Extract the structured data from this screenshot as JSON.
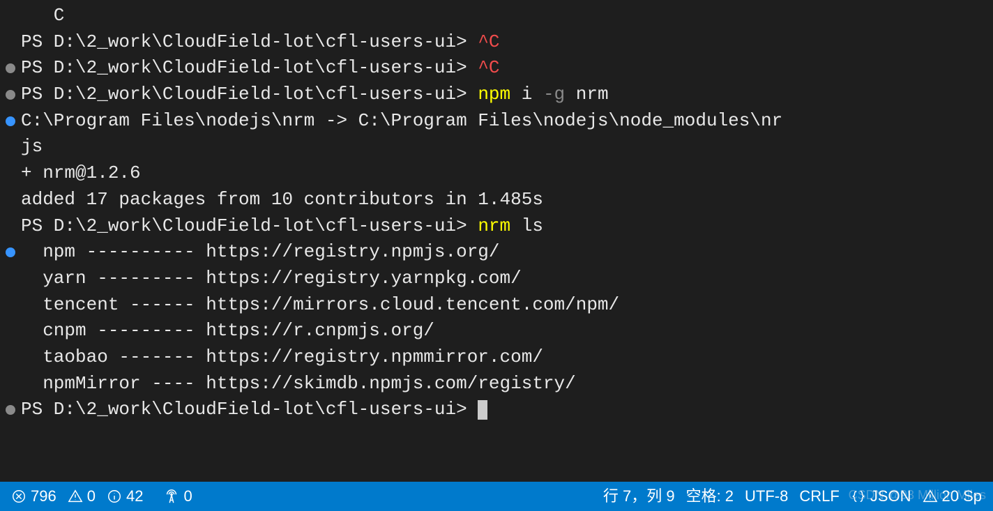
{
  "lines": [
    {
      "marker": "",
      "segments": [
        {
          "cls": "white",
          "t": "   C"
        }
      ]
    },
    {
      "marker": "",
      "segments": [
        {
          "cls": "white",
          "t": "PS D:\\2_work\\CloudField-lot\\cfl-users-ui> "
        },
        {
          "cls": "red",
          "t": "^C"
        }
      ]
    },
    {
      "marker": "grey",
      "segments": [
        {
          "cls": "white",
          "t": "PS D:\\2_work\\CloudField-lot\\cfl-users-ui> "
        },
        {
          "cls": "red",
          "t": "^C"
        }
      ]
    },
    {
      "marker": "grey",
      "segments": [
        {
          "cls": "white",
          "t": "PS D:\\2_work\\CloudField-lot\\cfl-users-ui> "
        },
        {
          "cls": "yellow",
          "t": "npm"
        },
        {
          "cls": "white",
          "t": " i "
        },
        {
          "cls": "grey",
          "t": "-g"
        },
        {
          "cls": "white",
          "t": " nrm"
        }
      ]
    },
    {
      "marker": "blue",
      "segments": [
        {
          "cls": "white",
          "t": "C:\\Program Files\\nodejs\\nrm -> C:\\Program Files\\nodejs\\node_modules\\nr"
        }
      ]
    },
    {
      "marker": "",
      "segments": [
        {
          "cls": "white",
          "t": "js"
        }
      ]
    },
    {
      "marker": "",
      "segments": [
        {
          "cls": "white",
          "t": "+ nrm@1.2.6"
        }
      ]
    },
    {
      "marker": "",
      "segments": [
        {
          "cls": "white",
          "t": "added 17 packages from 10 contributors in 1.485s"
        }
      ]
    },
    {
      "marker": "",
      "segments": [
        {
          "cls": "white",
          "t": "PS D:\\2_work\\CloudField-lot\\cfl-users-ui> "
        },
        {
          "cls": "yellow",
          "t": "nrm"
        },
        {
          "cls": "white",
          "t": " ls"
        }
      ]
    },
    {
      "marker": "blue",
      "segments": [
        {
          "cls": "white",
          "t": "  npm ---------- https://registry.npmjs.org/"
        }
      ]
    },
    {
      "marker": "",
      "segments": [
        {
          "cls": "white",
          "t": "  yarn --------- https://registry.yarnpkg.com/"
        }
      ]
    },
    {
      "marker": "",
      "segments": [
        {
          "cls": "white",
          "t": "  tencent ------ https://mirrors.cloud.tencent.com/npm/"
        }
      ]
    },
    {
      "marker": "",
      "segments": [
        {
          "cls": "white",
          "t": "  cnpm --------- https://r.cnpmjs.org/"
        }
      ]
    },
    {
      "marker": "",
      "segments": [
        {
          "cls": "white",
          "t": "  taobao ------- https://registry.npmmirror.com/"
        }
      ]
    },
    {
      "marker": "",
      "segments": [
        {
          "cls": "white",
          "t": "  npmMirror ---- https://skimdb.npmjs.com/registry/"
        }
      ]
    },
    {
      "marker": "grey",
      "segments": [
        {
          "cls": "white",
          "t": "PS D:\\2_work\\CloudField-lot\\cfl-users-ui> "
        }
      ],
      "cursor": true
    }
  ],
  "status": {
    "errors": "796",
    "warnings": "0",
    "infos": "42",
    "port": "0",
    "cursor_pos": "行 7，列 9",
    "indent": "空格: 2",
    "encoding": "UTF-8",
    "eol": "CRLF",
    "lang": "JSON",
    "right_warn": "20 Sp"
  },
  "watermark": "CSDN @93 Million Miles"
}
